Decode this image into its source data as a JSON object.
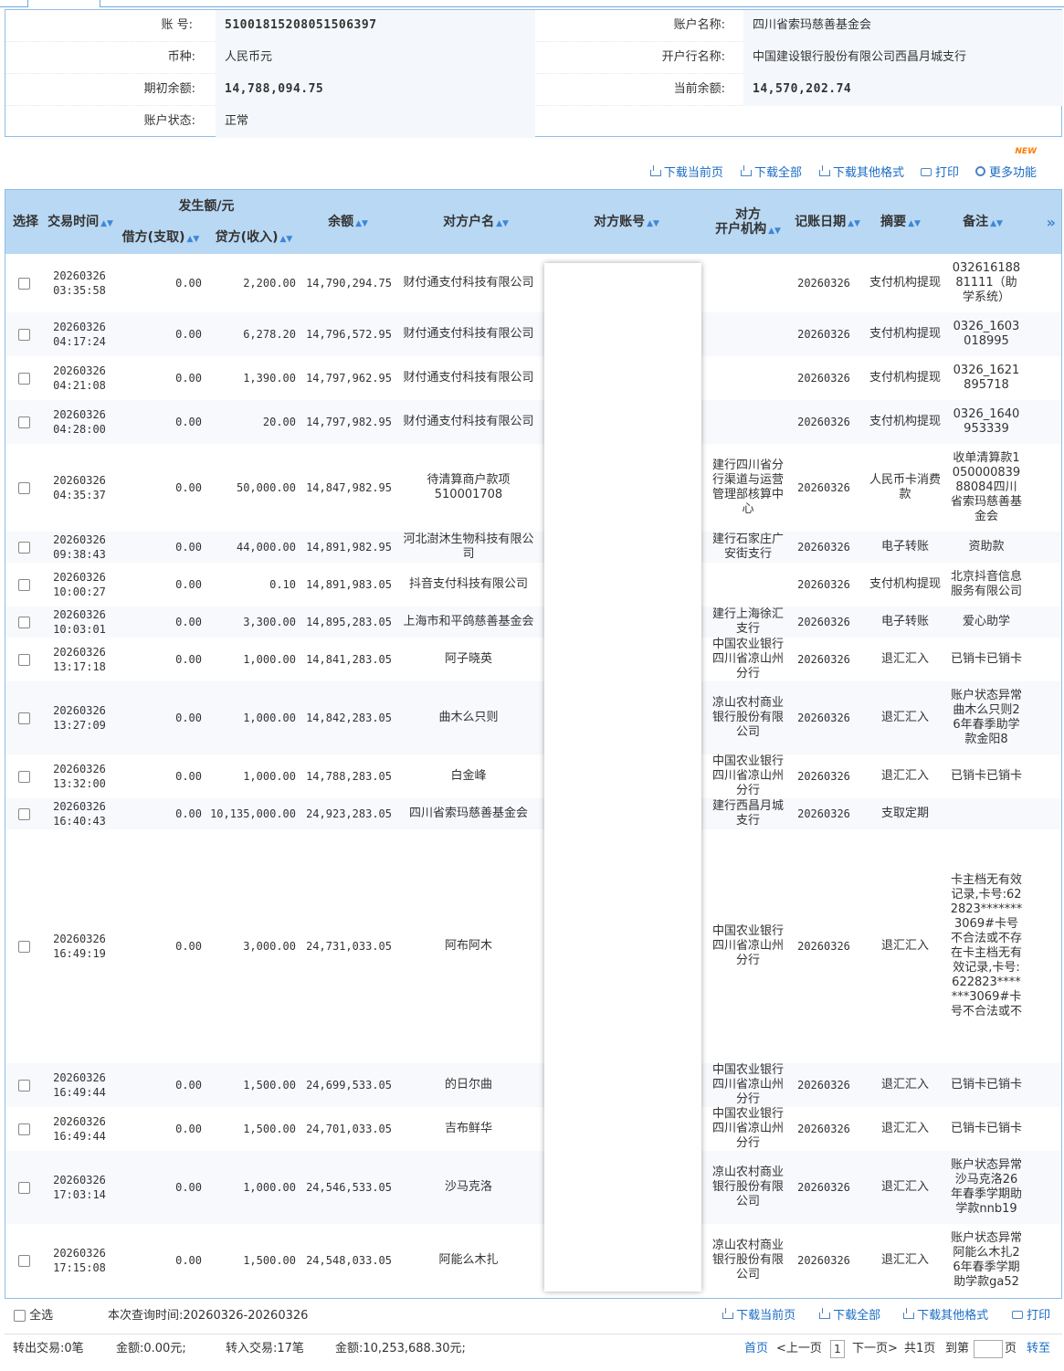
{
  "account": {
    "number_label": "账      号:",
    "number": "51001815208051506397",
    "name_label": "账户名称:",
    "name": "四川省索玛慈善基金会",
    "currency_label": "币种:",
    "currency": "人民币元",
    "bank_label": "开户行名称:",
    "bank": "中国建设银行股份有限公司西昌月城支行",
    "opening_label": "期初余额:",
    "opening": "14,788,094.75",
    "current_label": "当前余额:",
    "current": "14,570,202.74",
    "status_label": "账户状态:",
    "status": "正常"
  },
  "toolbar": {
    "download_page": "下载当前页",
    "download_all": "下载全部",
    "download_other": "下载其他格式",
    "print": "打印",
    "more": "更多功能",
    "new_badge": "NEW"
  },
  "table": {
    "headers": {
      "select": "选择",
      "time": "交易时间",
      "amount_group": "发生额/元",
      "debit": "借方(支取)",
      "credit": "贷方(收入)",
      "balance": "余额",
      "counterparty": "对方户名",
      "counter_account": "对方账号",
      "counter_bank_1": "对方",
      "counter_bank_2": "开户机构",
      "date": "记账日期",
      "memo": "摘要",
      "note": "备注",
      "more": "»"
    },
    "rows": [
      {
        "d": "20260326",
        "t": "03:35:58",
        "debit": "0.00",
        "credit": "2,200.00",
        "balance": "14,790,294.75",
        "name": "财付通支付科技有限公司",
        "bank": "",
        "date": "20260326",
        "memo": "支付机构提现",
        "note": "03261618881111（助学系统）"
      },
      {
        "d": "20260326",
        "t": "04:17:24",
        "debit": "0.00",
        "credit": "6,278.20",
        "balance": "14,796,572.95",
        "name": "财付通支付科技有限公司",
        "bank": "",
        "date": "20260326",
        "memo": "支付机构提现",
        "note": "0326_1603018995"
      },
      {
        "d": "20260326",
        "t": "04:21:08",
        "debit": "0.00",
        "credit": "1,390.00",
        "balance": "14,797,962.95",
        "name": "财付通支付科技有限公司",
        "bank": "",
        "date": "20260326",
        "memo": "支付机构提现",
        "note": "0326_1621895718"
      },
      {
        "d": "20260326",
        "t": "04:28:00",
        "debit": "0.00",
        "credit": "20.00",
        "balance": "14,797,982.95",
        "name": "财付通支付科技有限公司",
        "bank": "",
        "date": "20260326",
        "memo": "支付机构提现",
        "note": "0326_1640953339"
      },
      {
        "d": "20260326",
        "t": "04:35:37",
        "debit": "0.00",
        "credit": "50,000.00",
        "balance": "14,847,982.95",
        "name": "待清算商户款项510001708",
        "bank": "建行四川省分行渠道与运营管理部核算中心",
        "date": "20260326",
        "memo": "人民币卡消费款",
        "note": "收单清算款105000083988084四川省索玛慈善基金会"
      },
      {
        "d": "20260326",
        "t": "09:38:43",
        "debit": "0.00",
        "credit": "44,000.00",
        "balance": "14,891,982.95",
        "name": "河北澍沐生物科技有限公司",
        "bank": "建行石家庄广安街支行",
        "date": "20260326",
        "memo": "电子转账",
        "note": "资助款"
      },
      {
        "d": "20260326",
        "t": "10:00:27",
        "debit": "0.00",
        "credit": "0.10",
        "balance": "14,891,983.05",
        "name": "抖音支付科技有限公司",
        "bank": "",
        "date": "20260326",
        "memo": "支付机构提现",
        "note": "北京抖音信息服务有限公司"
      },
      {
        "d": "20260326",
        "t": "10:03:01",
        "debit": "0.00",
        "credit": "3,300.00",
        "balance": "14,895,283.05",
        "name": "上海市和平鸽慈善基金会",
        "bank": "建行上海徐汇支行",
        "date": "20260326",
        "memo": "电子转账",
        "note": "爱心助学"
      },
      {
        "d": "20260326",
        "t": "13:17:18",
        "debit": "0.00",
        "credit": "1,000.00",
        "balance": "14,841,283.05",
        "name": "阿子晓英",
        "bank": "中国农业银行四川省凉山州分行",
        "date": "20260326",
        "memo": "退汇汇入",
        "note": "已销卡已销卡"
      },
      {
        "d": "20260326",
        "t": "13:27:09",
        "debit": "0.00",
        "credit": "1,000.00",
        "balance": "14,842,283.05",
        "name": "曲木么只则",
        "bank": "凉山农村商业银行股份有限公司",
        "date": "20260326",
        "memo": "退汇汇入",
        "note": "账户状态异常曲木么只则26年春季助学款金阳8"
      },
      {
        "d": "20260326",
        "t": "13:32:00",
        "debit": "0.00",
        "credit": "1,000.00",
        "balance": "14,788,283.05",
        "name": "白金峰",
        "bank": "中国农业银行四川省凉山州分行",
        "date": "20260326",
        "memo": "退汇汇入",
        "note": "已销卡已销卡"
      },
      {
        "d": "20260326",
        "t": "16:40:43",
        "debit": "0.00",
        "credit": "10,135,000.00",
        "balance": "24,923,283.05",
        "name": "四川省索玛慈善基金会",
        "bank": "建行西昌月城支行",
        "date": "20260326",
        "memo": "支取定期",
        "note": ""
      },
      {
        "d": "20260326",
        "t": "16:49:19",
        "debit": "0.00",
        "credit": "3,000.00",
        "balance": "24,731,033.05",
        "name": "阿布阿木",
        "bank": "中国农业银行四川省凉山州分行",
        "date": "20260326",
        "memo": "退汇汇入",
        "note": "卡主档无有效记录,卡号:622823*******3069#卡号不合法或不存在卡主档无有效记录,卡号:622823*******3069#卡号不合法或不"
      },
      {
        "d": "20260326",
        "t": "16:49:44",
        "debit": "0.00",
        "credit": "1,500.00",
        "balance": "24,699,533.05",
        "name": "的日尔曲",
        "bank": "中国农业银行四川省凉山州分行",
        "date": "20260326",
        "memo": "退汇汇入",
        "note": "已销卡已销卡"
      },
      {
        "d": "20260326",
        "t": "16:49:44",
        "debit": "0.00",
        "credit": "1,500.00",
        "balance": "24,701,033.05",
        "name": "吉布鲜华",
        "bank": "中国农业银行四川省凉山州分行",
        "date": "20260326",
        "memo": "退汇汇入",
        "note": "已销卡已销卡"
      },
      {
        "d": "20260326",
        "t": "17:03:14",
        "debit": "0.00",
        "credit": "1,000.00",
        "balance": "24,546,533.05",
        "name": "沙马克洛",
        "bank": "凉山农村商业银行股份有限公司",
        "date": "20260326",
        "memo": "退汇汇入",
        "note": "账户状态异常沙马克洛26年春季学期助学款nnb19"
      },
      {
        "d": "20260326",
        "t": "17:15:08",
        "debit": "0.00",
        "credit": "1,500.00",
        "balance": "24,548,033.05",
        "name": "阿能么木扎",
        "bank": "凉山农村商业银行股份有限公司",
        "date": "20260326",
        "memo": "退汇汇入",
        "note": "账户状态异常阿能么木扎26年春季学期助学款ga52"
      }
    ]
  },
  "footer": {
    "select_all": "全选",
    "query_time": "本次查询时间:20260326-20260326",
    "download_page": "下载当前页",
    "download_all": "下载全部",
    "download_other": "下载其他格式",
    "print": "打印",
    "out_summary": "转出交易:0笔",
    "out_amount": "金额:0.00元;",
    "in_summary": "转入交易:17笔",
    "in_amount": "金额:10,253,688.30元;",
    "first": "首页",
    "prev": "<上一页",
    "page": "1",
    "next": "下一页>",
    "total": "共1页",
    "goto": "到第",
    "page_unit": "页",
    "go": "转至"
  }
}
